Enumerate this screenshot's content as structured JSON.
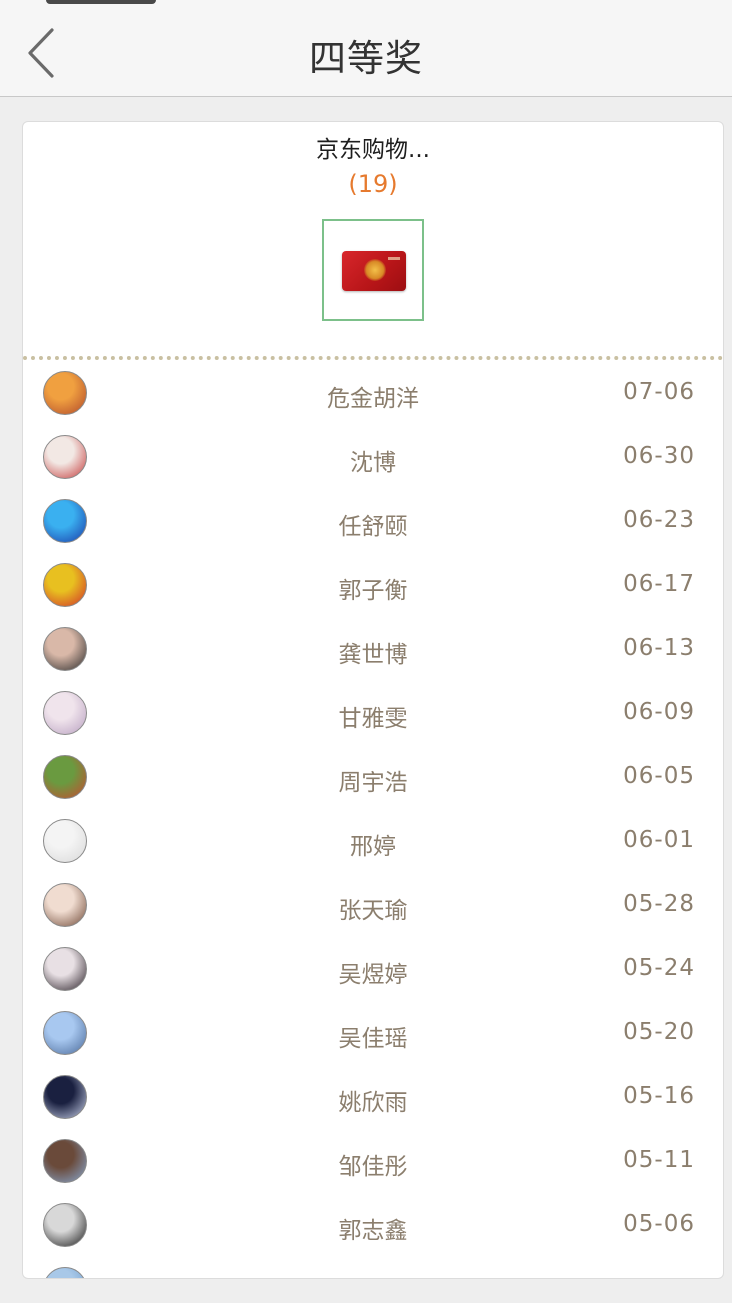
{
  "header": {
    "title": "四等奖"
  },
  "prize": {
    "name": "京东购物...",
    "count": "(19)",
    "image_icon": "jd-gift-card-icon"
  },
  "winners": [
    {
      "name": "危金胡洋",
      "date": "07-06",
      "avatar_colors": [
        "#f0a040",
        "#b0482a"
      ]
    },
    {
      "name": "沈博",
      "date": "06-30",
      "avatar_colors": [
        "#f2e8e4",
        "#c43a3a"
      ]
    },
    {
      "name": "任舒颐",
      "date": "06-23",
      "avatar_colors": [
        "#3ab0f0",
        "#1a3aa8"
      ]
    },
    {
      "name": "郭子衡",
      "date": "06-17",
      "avatar_colors": [
        "#e8c020",
        "#d0302a"
      ]
    },
    {
      "name": "龚世博",
      "date": "06-13",
      "avatar_colors": [
        "#d9b8a8",
        "#2a2a2a"
      ]
    },
    {
      "name": "甘雅雯",
      "date": "06-09",
      "avatar_colors": [
        "#f0e4ec",
        "#b8a0c0"
      ]
    },
    {
      "name": "周宇浩",
      "date": "06-05",
      "avatar_colors": [
        "#6a9a40",
        "#c84a30"
      ]
    },
    {
      "name": "邢婷",
      "date": "06-01",
      "avatar_colors": [
        "#f4f4f4",
        "#d8d8d8"
      ]
    },
    {
      "name": "张天瑜",
      "date": "05-28",
      "avatar_colors": [
        "#f0dcd0",
        "#704a38"
      ]
    },
    {
      "name": "吴煜婷",
      "date": "05-24",
      "avatar_colors": [
        "#e8e0e4",
        "#2a2028"
      ]
    },
    {
      "name": "吴佳瑶",
      "date": "05-20",
      "avatar_colors": [
        "#a8c8f0",
        "#4a6a9a"
      ]
    },
    {
      "name": "姚欣雨",
      "date": "05-16",
      "avatar_colors": [
        "#1a2040",
        "#c8d0e8"
      ]
    },
    {
      "name": "邹佳彤",
      "date": "05-11",
      "avatar_colors": [
        "#6a4a3a",
        "#88a8d0"
      ]
    },
    {
      "name": "郭志鑫",
      "date": "05-06",
      "avatar_colors": [
        "#d8d8d8",
        "#1a1a1a"
      ]
    },
    {
      "name": "",
      "date": "",
      "avatar_colors": [
        "#a8c8e8",
        "#6a98c8"
      ]
    }
  ]
}
